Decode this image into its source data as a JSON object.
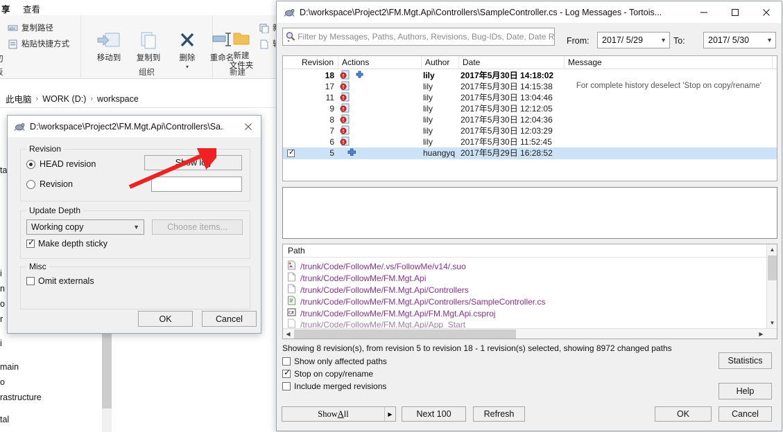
{
  "explorer": {
    "tab_label": "查看",
    "groups": [
      {
        "name": "clipboard",
        "caption": "板",
        "items": []
      },
      {
        "name": "organize",
        "caption": "组织",
        "items": []
      },
      {
        "name": "new",
        "caption": "新建",
        "items": []
      }
    ],
    "small_items": [
      {
        "icon": "copy-path-icon",
        "label": "复制路径"
      },
      {
        "icon": "paste-shortcut-icon",
        "label": "粘贴快捷方式"
      }
    ],
    "clipped_left_labels": [
      "切",
      "板"
    ],
    "big_items": [
      {
        "icon": "move-to-icon",
        "label": "移动到"
      },
      {
        "icon": "copy-to-icon",
        "label": "复制到"
      },
      {
        "icon": "delete-icon",
        "label": "删除"
      },
      {
        "icon": "rename-icon",
        "label": "重命名"
      },
      {
        "icon": "new-folder-icon",
        "label": "新建\n文件夹"
      }
    ],
    "new_group_items": [
      {
        "icon": "new-item-icon",
        "label": "新建"
      },
      {
        "icon": "easy-access-icon",
        "label": "轻松"
      }
    ],
    "breadcrumb": [
      "此电脑",
      "WORK (D:)",
      "workspace"
    ],
    "breadcrumb_separator": "›",
    "files": [
      "ta",
      "i",
      "n",
      "o",
      "r",
      "i",
      "main",
      "o",
      "rastructure",
      "tal"
    ]
  },
  "log_window": {
    "title": "D:\\workspace\\Project2\\FM.Mgt.Api\\Controllers\\SampleController.cs - Log Messages - Tortois...",
    "icon": "tortoisesvn-icon",
    "window_buttons": {
      "minimize": "minimize-icon",
      "maximize": "maximize-icon",
      "close": "close-icon"
    },
    "filter": {
      "icon": "search-icon",
      "placeholder": "Filter by Messages, Paths, Authors, Revisions, Bug-IDs, Date, Date Ran",
      "value": ""
    },
    "from_label": "From:",
    "from_value": "2017/ 5/29",
    "to_label": "To:",
    "to_value": "2017/ 5/30",
    "revisions": {
      "columns": [
        "Revision",
        "Actions",
        "Author",
        "Date",
        "Message"
      ],
      "rows": [
        {
          "revision": "18",
          "actions": [
            "modified-icon",
            "added-icon"
          ],
          "author": "lily",
          "date": "2017年5月30日 14:18:02",
          "message": "",
          "bold": true,
          "selected": false,
          "checked": false
        },
        {
          "revision": "17",
          "actions": [
            "modified-icon"
          ],
          "author": "lily",
          "date": "2017年5月30日 14:15:38",
          "message": "",
          "bold": false,
          "selected": false,
          "checked": false
        },
        {
          "revision": "11",
          "actions": [
            "modified-icon"
          ],
          "author": "lily",
          "date": "2017年5月30日 13:04:46",
          "message": "",
          "bold": false,
          "selected": false,
          "checked": false
        },
        {
          "revision": "9",
          "actions": [
            "modified-icon"
          ],
          "author": "lily",
          "date": "2017年5月30日 12:12:05",
          "message": "",
          "bold": false,
          "selected": false,
          "checked": false
        },
        {
          "revision": "8",
          "actions": [
            "modified-icon"
          ],
          "author": "lily",
          "date": "2017年5月30日 12:04:36",
          "message": "",
          "bold": false,
          "selected": false,
          "checked": false
        },
        {
          "revision": "7",
          "actions": [
            "modified-icon"
          ],
          "author": "lily",
          "date": "2017年5月30日 12:03:29",
          "message": "",
          "bold": false,
          "selected": false,
          "checked": false
        },
        {
          "revision": "6",
          "actions": [
            "modified-icon"
          ],
          "author": "lily",
          "date": "2017年5月30日 11:52:45",
          "message": "",
          "bold": false,
          "selected": false,
          "checked": false
        },
        {
          "revision": "5",
          "actions": [
            "added-icon"
          ],
          "author": "huangyq",
          "date": "2017年5月29日 16:28:52",
          "message": "",
          "bold": false,
          "selected": true,
          "checked": true
        }
      ],
      "hint": "For complete history deselect 'Stop on copy/rename'"
    },
    "message_text": "",
    "paths": {
      "header": "Path",
      "rows": [
        {
          "icon": "suo-file-icon",
          "path": "/trunk/Code/FollowMe/.vs/FollowMe/v14/.suo"
        },
        {
          "icon": "folder-file-icon",
          "path": "/trunk/Code/FollowMe/FM.Mgt.Api"
        },
        {
          "icon": "folder-file-icon",
          "path": "/trunk/Code/FollowMe/FM.Mgt.Api/Controllers"
        },
        {
          "icon": "cs-text-file-icon",
          "path": "/trunk/Code/FollowMe/FM.Mgt.Api/Controllers/SampleController.cs"
        },
        {
          "icon": "csproj-file-icon",
          "path": "/trunk/Code/FollowMe/FM.Mgt.Api/FM.Mgt.Api.csproj"
        },
        {
          "icon": "folder-file-icon",
          "path": "/trunk/Code/FollowMe/FM.Mgt.Api/App_Start"
        }
      ]
    },
    "status": "Showing 8 revision(s), from revision 5 to revision 18 - 1 revision(s) selected, showing 8972 changed paths",
    "options": [
      {
        "label": "Show only affected paths",
        "checked": false
      },
      {
        "label": "Stop on copy/rename",
        "checked": true
      },
      {
        "label": "Include merged revisions",
        "checked": false
      }
    ],
    "buttons": {
      "statistics": "Statistics",
      "help": "Help",
      "show_all_prefix": "Show ",
      "show_all_accel": "A",
      "show_all_suffix": "ll",
      "next_100": "Next 100",
      "refresh": "Refresh",
      "ok": "OK",
      "cancel": "Cancel"
    }
  },
  "update_dialog": {
    "title": "D:\\workspace\\Project2\\FM.Mgt.Api\\Controllers\\Sa...",
    "icon": "tortoisesvn-icon",
    "close": "close-icon",
    "revision_group": "Revision",
    "head_revision_label": "HEAD revision",
    "head_revision_selected": true,
    "revision_label": "Revision",
    "revision_selected": false,
    "revision_value": "",
    "show_log_button": "Show log",
    "update_depth_group": "Update Depth",
    "depth_value": "Working copy",
    "choose_items_button": "Choose items...",
    "make_depth_sticky": {
      "label": "Make depth sticky",
      "checked": true
    },
    "misc_group": "Misc",
    "omit_externals": {
      "label": "Omit externals",
      "checked": false
    },
    "ok_button": "OK",
    "cancel_button": "Cancel"
  },
  "annotation": {
    "name": "red-arrow",
    "color": "#ee2222",
    "points_to": "Show log"
  }
}
